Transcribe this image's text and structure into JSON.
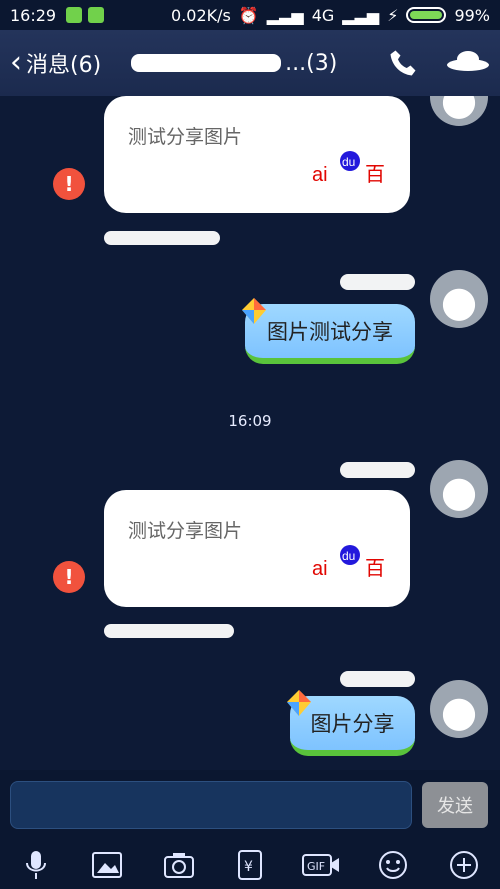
{
  "status_bar": {
    "time": "16:29",
    "network_speed": "0.02K/s",
    "network_type": "4G",
    "battery": "99%"
  },
  "nav": {
    "back_label": "消息(6)",
    "title_suffix": "...(3)",
    "icons": [
      "phone-icon",
      "ufo-icon"
    ]
  },
  "chat": {
    "timestamp": "16:09",
    "messages": [
      {
        "type": "share-card",
        "title": "测试分享图片",
        "source_logo": "baidu"
      },
      {
        "type": "bubble",
        "text": "图片测试分享"
      },
      {
        "type": "share-card",
        "title": "测试分享图片",
        "source_logo": "baidu"
      },
      {
        "type": "bubble",
        "text": "图片分享"
      }
    ]
  },
  "composer": {
    "send_label": "发送",
    "input_value": ""
  },
  "toolbar": {
    "icons": [
      "microphone-icon",
      "image-icon",
      "camera-icon",
      "red-packet-icon",
      "gif-icon",
      "emoji-icon",
      "plus-icon"
    ]
  },
  "colors": {
    "background": "#0d1a36",
    "bubble": "#8fd0ff",
    "alert": "#f1523d",
    "battery": "#7ed957"
  }
}
